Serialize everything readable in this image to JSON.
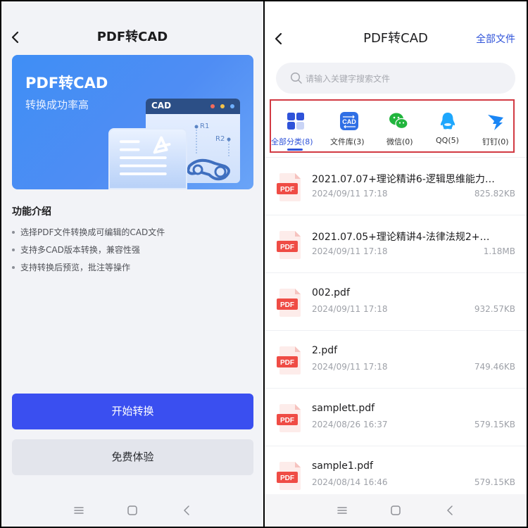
{
  "left": {
    "title": "PDF转CAD",
    "banner": {
      "title": "PDF转CAD",
      "subtitle": "转换成功率高",
      "window_label": "CAD",
      "r1": "R1",
      "r2": "R2"
    },
    "features": {
      "title": "功能介绍",
      "items": [
        "选择PDF文件转换成可编辑的CAD文件",
        "支持多CAD版本转换，兼容性强",
        "支持转换后预览，批注等操作"
      ]
    },
    "primary_button": "开始转换",
    "secondary_button": "免费体验"
  },
  "right": {
    "title": "PDF转CAD",
    "all_files": "全部文件",
    "search_placeholder": "请输入关键字搜索文件",
    "categories": [
      {
        "label": "全部分类(8)",
        "icon": "grid-icon",
        "selected": true
      },
      {
        "label": "文件库(3)",
        "icon": "cad-library-icon"
      },
      {
        "label": "微信(0)",
        "icon": "wechat-icon"
      },
      {
        "label": "QQ(5)",
        "icon": "qq-icon"
      },
      {
        "label": "钉钉(0)",
        "icon": "dingtalk-icon"
      }
    ],
    "pdf_badge": "PDF",
    "files": [
      {
        "name": "2021.07.07+理论精讲6-逻辑思维能力…",
        "date": "2024/09/11  17:18",
        "size": "825.82KB"
      },
      {
        "name": "2021.07.05+理论精讲4-法律法规2+…",
        "date": "2024/09/11  17:18",
        "size": "1.18MB"
      },
      {
        "name": "002.pdf",
        "date": "2024/09/11  17:18",
        "size": "932.57KB"
      },
      {
        "name": "2.pdf",
        "date": "2024/09/11  17:18",
        "size": "749.46KB"
      },
      {
        "name": "samplett.pdf",
        "date": "2024/08/26  16:37",
        "size": "579.15KB"
      },
      {
        "name": "sample1.pdf",
        "date": "2024/08/14  16:46",
        "size": "579.15KB"
      }
    ]
  },
  "colors": {
    "accent": "#3a4ff0",
    "link": "#2f53d9",
    "highlight_border": "#d23a43",
    "pdf_red": "#ef4c45"
  }
}
